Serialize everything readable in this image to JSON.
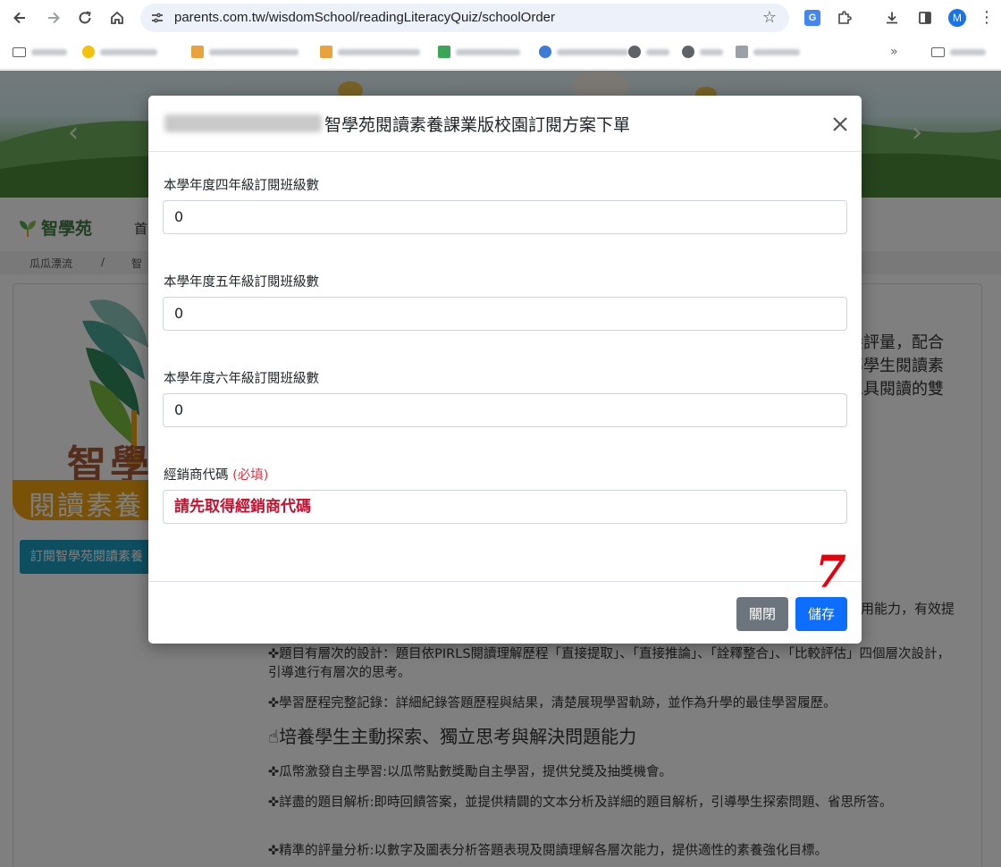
{
  "browser": {
    "url": "parents.com.tw/wisdomSchool/readingLiteracyQuiz/schoolOrder",
    "profile_initial": "M",
    "translate_badge": "G",
    "overflow_chevron": "»",
    "icons": [
      "back-icon",
      "forward-icon",
      "reload-icon",
      "home-icon",
      "site-info-icon",
      "star-icon",
      "translate-icon",
      "extensions-icon",
      "download-icon",
      "side-panel-icon",
      "menu-icon"
    ]
  },
  "site": {
    "brand": "智學苑",
    "nav_first": "首",
    "breadcrumb": [
      "瓜瓜漂流",
      "/",
      "智"
    ],
    "big_title": "智學",
    "subtitle": "閱讀素養",
    "subscribe_button": "訂閱智學苑閱讀素養",
    "intro_lines": [
      "養評量，配合",
      "導學生閱讀素",
      "工具閱讀的雙"
    ],
    "feature_tail": "用能力，有效提",
    "feature_1": "✜題目有層次的設計：題目依PIRLS閱讀理解歷程「直接提取」、「直接推論」、「詮釋整合」、「比較評估」四個層次設計，引導進行有層次的思考。",
    "feature_2": "✜學習歷程完整記錄：詳細紀錄答題歷程與結果，清楚展現學習軌跡，並作為升學的最佳學習履歷。",
    "heading_2": "培養學生主動探索、獨立思考與解決問題能力",
    "feature_3": "✜瓜幣激發自主學習:以瓜幣點數獎勵自主學習，提供兌獎及抽獎機會。",
    "feature_4": "✜詳盡的題目解析:即時回饋答案，並提供精闢的文本分析及詳細的題目解析，引導學生探索問題、省思所答。",
    "feature_5": "✜精準的評量分析:以數字及圖表分析答題表現及閱讀理解各層次能力，提供適性的素養強化目標。"
  },
  "modal": {
    "title": "智學苑閱讀素養課業版校園訂閱方案下單",
    "fields": [
      {
        "label": "本學年度四年級訂閱班級數",
        "value": "0"
      },
      {
        "label": "本學年度五年級訂閱班級數",
        "value": "0"
      },
      {
        "label": "本學年度六年級訂閱班級數",
        "value": "0"
      }
    ],
    "dealer": {
      "label": "經銷商代碼",
      "required": "(必填)",
      "value": "請先取得經銷商代碼"
    },
    "close_button": "關閉",
    "save_button": "儲存"
  },
  "annotation": {
    "step_number": "7",
    "color": "#e8000d"
  },
  "colors": {
    "primary": "#0d6efd",
    "secondary": "#6c757d",
    "danger": "#dc3545",
    "subscribe": "#1b9dc2",
    "subtitle_pill": "#f2a30f"
  }
}
